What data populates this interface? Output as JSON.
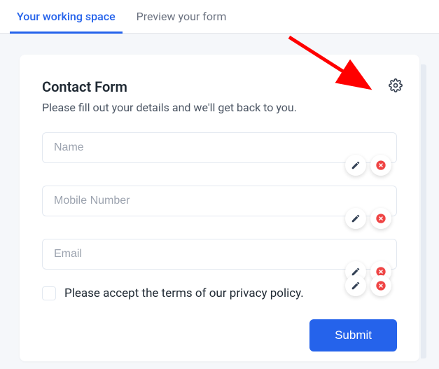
{
  "tabs": {
    "working_space": "Your working space",
    "preview": "Preview your form"
  },
  "form": {
    "title": "Contact Form",
    "description": "Please fill out your details and we'll get back to you.",
    "fields": {
      "name": {
        "placeholder": "Name",
        "value": ""
      },
      "mobile": {
        "placeholder": "Mobile Number",
        "value": ""
      },
      "email": {
        "placeholder": "Email",
        "value": ""
      }
    },
    "checkbox_label": "Please accept the terms of our privacy policy.",
    "submit_label": "Submit"
  },
  "colors": {
    "accent": "#2563eb",
    "edit_icon": "#334155",
    "delete_icon": "#ef4444",
    "arrow": "#ff0000"
  }
}
